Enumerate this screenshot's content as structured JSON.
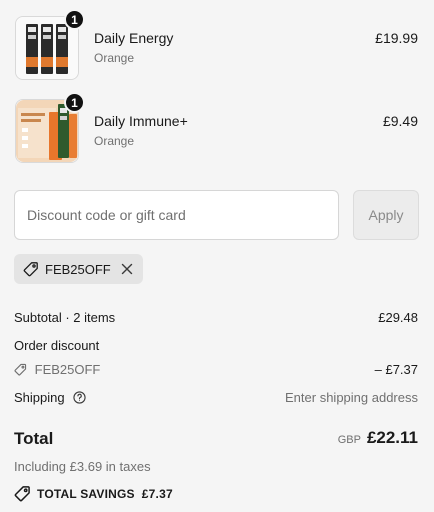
{
  "items": [
    {
      "name": "Daily Energy",
      "variant": "Orange",
      "price": "£19.99",
      "quantity": "1"
    },
    {
      "name": "Daily Immune+",
      "variant": "Orange",
      "price": "£9.49",
      "quantity": "1"
    }
  ],
  "discount": {
    "placeholder": "Discount code or gift card",
    "apply_label": "Apply",
    "applied_code": "FEB25OFF"
  },
  "summary": {
    "subtotal_label": "Subtotal · 2 items",
    "subtotal_value": "£29.48",
    "order_discount_label": "Order discount",
    "discount_code": "FEB25OFF",
    "discount_value": "– £7.37",
    "shipping_label": "Shipping",
    "shipping_value": "Enter shipping address",
    "total_label": "Total",
    "currency": "GBP",
    "total_value": "£22.11",
    "taxes_text": "Including £3.69 in taxes",
    "savings_text": "TOTAL SAVINGS  £7.37"
  },
  "colors": {
    "background": "#f5f5f5",
    "muted_text": "#707070",
    "tag_bg": "#e4e4e4",
    "badge_bg": "#111111"
  }
}
